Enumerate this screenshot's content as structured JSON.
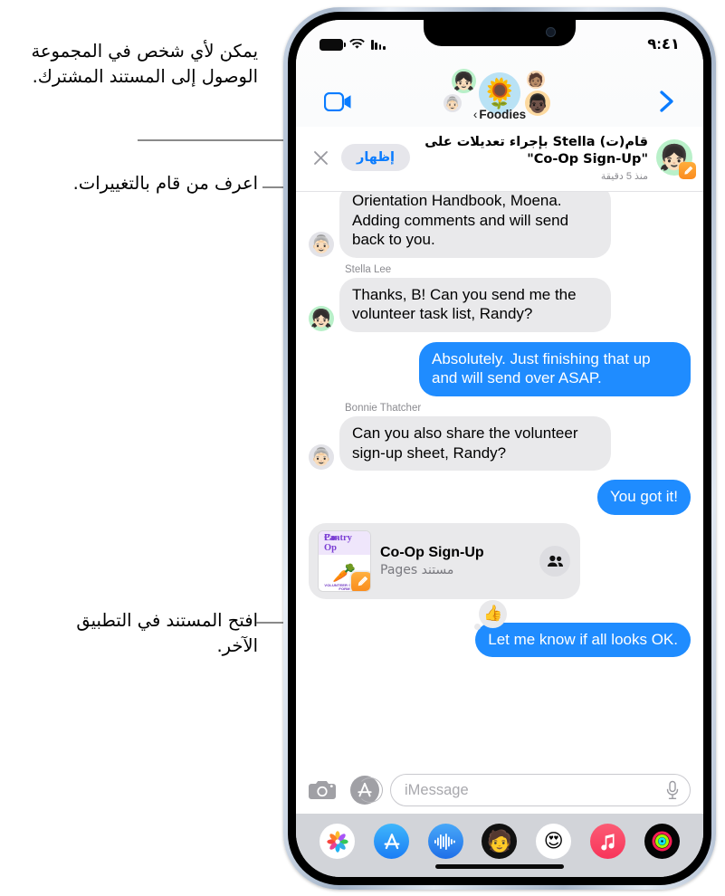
{
  "annotations": [
    {
      "id": "callout-sharing",
      "text": "يمكن لأي شخص في المجموعة الوصول إلى المستند المشترك."
    },
    {
      "id": "callout-changes",
      "text": "اعرف من قام بالتغييرات."
    },
    {
      "id": "callout-open-doc",
      "text": "افتح المستند في التطبيق الآخر."
    }
  ],
  "status_bar": {
    "time": "٩:٤١",
    "battery_icon": "battery-full-icon",
    "wifi_icon": "wifi-icon",
    "cellular_icon": "cellular-bars-icon"
  },
  "nav": {
    "facetime_icon": "video-camera-icon",
    "back_icon": "chevron-right-icon",
    "group_name": "Foodies",
    "group_back_chevron": "‹",
    "avatars": [
      {
        "name": "group-avatar-center",
        "glyph": "🌻",
        "bg": "#b9e2f5"
      },
      {
        "name": "group-avatar-stella",
        "glyph": "👧🏻",
        "bg": "#b9f0c9"
      },
      {
        "name": "group-avatar-bonnie",
        "glyph": "👵🏻",
        "bg": "#e3e3e8"
      },
      {
        "name": "group-avatar-member-3",
        "glyph": "🧑🏽",
        "bg": "#fad9b5"
      },
      {
        "name": "group-avatar-member-4",
        "glyph": "👨🏿",
        "bg": "#fcd9a0"
      }
    ]
  },
  "collab_banner": {
    "title": "قام(ت) Stella بإجراء تعديلات على \"Co-Op Sign-Up\"",
    "time": "منذ 5 دقيقة",
    "show_button": "إظهار",
    "close_icon": "close-x-icon",
    "avatar_glyph": "👧🏻",
    "app_badge_icon": "pages-app-icon"
  },
  "messages": [
    {
      "type": "text",
      "side": "in",
      "clipped": true,
      "sender": "",
      "avatar": "👵🏻",
      "avatar_bg": "#e3e3e8",
      "text": "Orientation Handbook, Moena. Adding comments and will send back to you."
    },
    {
      "type": "text",
      "side": "in",
      "clipped": false,
      "sender": "Stella Lee",
      "avatar": "👧🏻",
      "avatar_bg": "#b9f0c9",
      "text": "Thanks, B! Can you send me the volunteer task list, Randy?"
    },
    {
      "type": "text",
      "side": "out",
      "clipped": false,
      "sender": "",
      "avatar": "",
      "avatar_bg": "",
      "text": "Absolutely. Just finishing that up and will send over ASAP."
    },
    {
      "type": "text",
      "side": "in",
      "clipped": false,
      "sender": "Bonnie Thatcher",
      "avatar": "👵🏻",
      "avatar_bg": "#e3e3e8",
      "text": "Can you also share the volunteer sign-up sheet, Randy?"
    },
    {
      "type": "text",
      "side": "out",
      "clipped": false,
      "sender": "",
      "avatar": "",
      "avatar_bg": "",
      "text": "You got it!"
    },
    {
      "type": "document",
      "side": "in",
      "title": "Co-Op Sign-Up",
      "subtitle": "مستند Pages",
      "thumb_title_line1": "Pantry",
      "thumb_title_line2": "Co-Op",
      "thumb_footer": "VOLUNTEER SIGN-UP FORM",
      "thumb_art": "🥕",
      "badge_icon": "pages-app-icon",
      "people_icon": "people-collaboration-icon"
    },
    {
      "type": "text",
      "side": "out",
      "clipped": false,
      "sender": "",
      "avatar": "",
      "avatar_bg": "",
      "text": "Let me know if all looks OK.",
      "reaction": "👍",
      "reaction_name": "thumbs-up-reaction"
    }
  ],
  "input_bar": {
    "camera_icon": "camera-icon",
    "appstore_icon": "app-store-icon",
    "placeholder": "iMessage",
    "value": "",
    "mic_icon": "microphone-icon"
  },
  "app_drawer": [
    {
      "name": "app-photos",
      "icon": "photos-icon",
      "glyph": "🌈"
    },
    {
      "name": "app-store",
      "icon": "app-store-icon",
      "glyph": ""
    },
    {
      "name": "app-audio",
      "icon": "audio-wave-icon",
      "glyph": ""
    },
    {
      "name": "app-memoji",
      "icon": "memoji-icon",
      "glyph": "🧑"
    },
    {
      "name": "app-stickers",
      "icon": "memoji-stickers-icon",
      "glyph": "😍"
    },
    {
      "name": "app-music",
      "icon": "music-note-icon",
      "glyph": ""
    },
    {
      "name": "app-fitness",
      "icon": "activity-rings-icon",
      "glyph": ""
    }
  ],
  "colors": {
    "imessage_blue": "#1f8cff",
    "bubble_gray": "#e9e9eb",
    "accent_blue": "#0a7cff",
    "drawer_bg": "#d2d4d9"
  }
}
